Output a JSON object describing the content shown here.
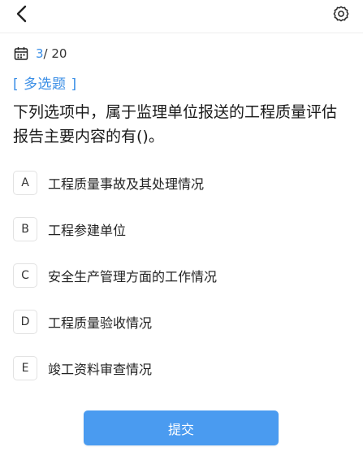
{
  "header": {
    "back_icon": "chevron-left-icon",
    "settings_icon": "gear-icon"
  },
  "progress": {
    "current": "3",
    "total": "/ 20"
  },
  "question_type": "[ 多选题 ]",
  "question_text": "下列选项中，属于监理单位报送的工程质量评估报告主要内容的有()。",
  "options": [
    {
      "letter": "A",
      "text": "工程质量事故及其处理情况"
    },
    {
      "letter": "B",
      "text": "工程参建单位"
    },
    {
      "letter": "C",
      "text": "安全生产管理方面的工作情况"
    },
    {
      "letter": "D",
      "text": "工程质量验收情况"
    },
    {
      "letter": "E",
      "text": "竣工资料审查情况"
    }
  ],
  "submit_label": "提交",
  "colors": {
    "accent": "#3a8ee6",
    "button": "#4a9bf0"
  }
}
